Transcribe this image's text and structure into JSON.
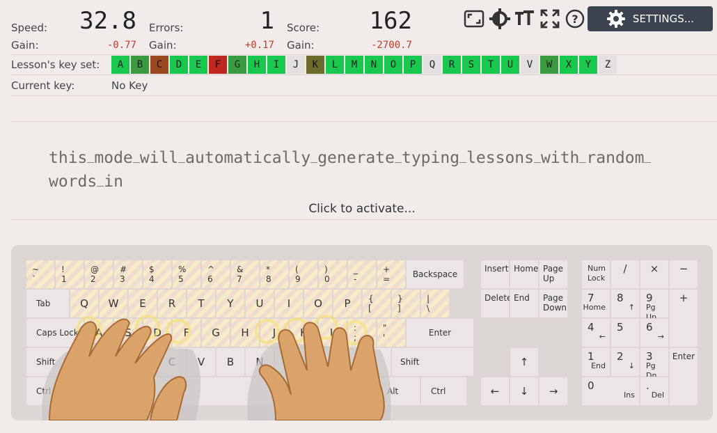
{
  "stats": [
    {
      "label": "Speed:",
      "value": "32.8",
      "gain_label": "Gain:",
      "gain": "-0.77"
    },
    {
      "label": "Errors:",
      "value": "1",
      "gain_label": "Gain:",
      "gain": "+0.17"
    },
    {
      "label": "Score:",
      "value": "162",
      "gain_label": "Gain:",
      "gain": "-2700.7"
    }
  ],
  "toolbar": {
    "icons": [
      "layout-icon",
      "theme-icon",
      "text-size-icon",
      "fullscreen-icon",
      "help-icon"
    ],
    "settings_label": "SETTINGS..."
  },
  "keyset": {
    "label": "Lesson's key set:",
    "keys": [
      {
        "k": "A",
        "c": "#19c94f"
      },
      {
        "k": "B",
        "c": "#3a9b3f"
      },
      {
        "k": "C",
        "c": "#9a4a1e"
      },
      {
        "k": "D",
        "c": "#19c94f"
      },
      {
        "k": "E",
        "c": "#19c94f"
      },
      {
        "k": "F",
        "c": "#c0281f"
      },
      {
        "k": "G",
        "c": "#3a9b3f"
      },
      {
        "k": "H",
        "c": "#19c94f"
      },
      {
        "k": "I",
        "c": "#19c94f"
      },
      {
        "k": "J",
        "c": "#e3e0df"
      },
      {
        "k": "K",
        "c": "#6e6a2c"
      },
      {
        "k": "L",
        "c": "#19c94f"
      },
      {
        "k": "M",
        "c": "#19c94f"
      },
      {
        "k": "N",
        "c": "#19c94f"
      },
      {
        "k": "O",
        "c": "#19c94f"
      },
      {
        "k": "P",
        "c": "#19c94f"
      },
      {
        "k": "Q",
        "c": "#e3e0df"
      },
      {
        "k": "R",
        "c": "#19c94f"
      },
      {
        "k": "S",
        "c": "#19c94f"
      },
      {
        "k": "T",
        "c": "#19c94f"
      },
      {
        "k": "U",
        "c": "#19c94f"
      },
      {
        "k": "V",
        "c": "#e3e0df"
      },
      {
        "k": "W",
        "c": "#3a9b3f"
      },
      {
        "k": "X",
        "c": "#19c94f"
      },
      {
        "k": "Y",
        "c": "#19c94f"
      },
      {
        "k": "Z",
        "c": "#e3e0df"
      }
    ]
  },
  "current_key": {
    "label": "Current key:",
    "value": "No Key"
  },
  "lesson": {
    "words": [
      "this",
      "mode",
      "will",
      "automatically",
      "generate",
      "typing",
      "lessons",
      "with",
      "random",
      "words",
      "in"
    ],
    "activate": "Click to activate..."
  },
  "keyboard": {
    "rows": [
      [
        {
          "t": "~",
          "b": "`"
        },
        {
          "t": "!",
          "b": "1"
        },
        {
          "t": "@",
          "b": "2"
        },
        {
          "t": "#",
          "b": "3"
        },
        {
          "t": "$",
          "b": "4"
        },
        {
          "t": "%",
          "b": "5"
        },
        {
          "t": "^",
          "b": "6"
        },
        {
          "t": "&",
          "b": "7"
        },
        {
          "t": "*",
          "b": "8"
        },
        {
          "t": "(",
          "b": "9"
        },
        {
          "t": ")",
          "b": "0"
        },
        {
          "t": "_",
          "b": "-"
        },
        {
          "t": "+",
          "b": "="
        },
        {
          "t": "Backspace"
        }
      ],
      [
        {
          "t": "Tab"
        },
        {
          "t": "Q"
        },
        {
          "t": "W"
        },
        {
          "t": "E"
        },
        {
          "t": "R"
        },
        {
          "t": "T"
        },
        {
          "t": "Y"
        },
        {
          "t": "U"
        },
        {
          "t": "I"
        },
        {
          "t": "O"
        },
        {
          "t": "P"
        },
        {
          "t": "{",
          "b": "["
        },
        {
          "t": "}",
          "b": "]"
        },
        {
          "t": "|",
          "b": "\\"
        }
      ],
      [
        {
          "t": "Caps Lock"
        },
        {
          "t": "A"
        },
        {
          "t": "S"
        },
        {
          "t": "D"
        },
        {
          "t": "F"
        },
        {
          "t": "G"
        },
        {
          "t": "H"
        },
        {
          "t": "J"
        },
        {
          "t": "K"
        },
        {
          "t": "L"
        },
        {
          "t": ":",
          "b": ";"
        },
        {
          "t": "\"",
          "b": "'"
        },
        {
          "t": "Enter"
        }
      ],
      [
        {
          "t": "Shift"
        },
        {
          "t": "Z"
        },
        {
          "t": "X"
        },
        {
          "t": "C"
        },
        {
          "t": "V"
        },
        {
          "t": "B"
        },
        {
          "t": "N"
        },
        {
          "t": "M"
        },
        {
          "t": "<",
          "b": ","
        },
        {
          "t": ">",
          "b": "."
        },
        {
          "t": "?",
          "b": "/"
        },
        {
          "t": "Shift"
        }
      ],
      [
        {
          "t": "Ctrl"
        },
        {
          "t": "Alt"
        },
        {
          "t": ""
        },
        {
          "t": "Alt"
        },
        {
          "t": "Ctrl"
        }
      ]
    ],
    "nav": [
      "Insert",
      "Home",
      "Page Up",
      "Delete",
      "End",
      "Page Down",
      "↑",
      "←",
      "↓",
      "→"
    ],
    "numpad": [
      {
        "t": "Num Lock"
      },
      {
        "t": "/"
      },
      {
        "t": "×"
      },
      {
        "t": "−"
      },
      {
        "t": "7",
        "s": "Home"
      },
      {
        "t": "8",
        "s": "↑"
      },
      {
        "t": "9",
        "s": "Pg Up"
      },
      {
        "t": "+"
      },
      {
        "t": "4",
        "s": "←"
      },
      {
        "t": "5",
        "s": ""
      },
      {
        "t": "6",
        "s": "→"
      },
      {
        "t": "1",
        "s": "End"
      },
      {
        "t": "2",
        "s": "↓"
      },
      {
        "t": "3",
        "s": "Pg Dn"
      },
      {
        "t": "Enter"
      },
      {
        "t": "0",
        "s": "Ins"
      },
      {
        "t": ".",
        "s": "Del"
      }
    ]
  }
}
